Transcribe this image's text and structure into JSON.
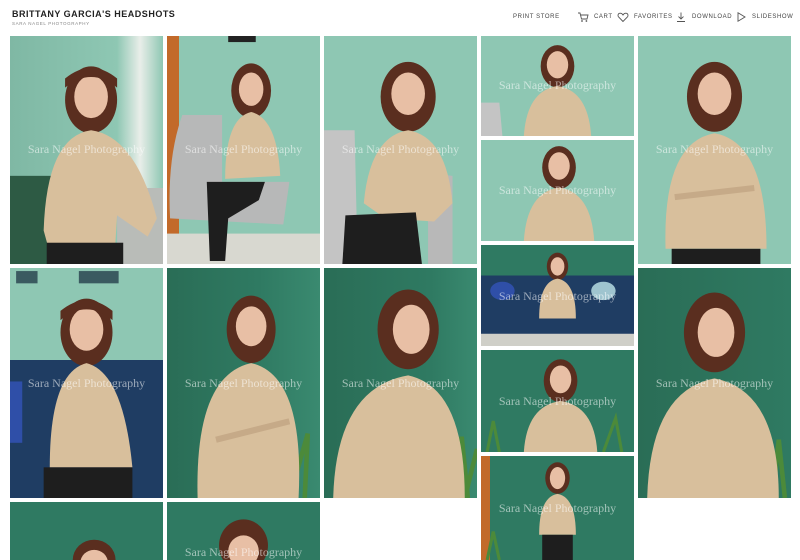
{
  "header": {
    "title": "BRITTANY GARCIA'S HEADSHOTS",
    "subtitle": "SARA NAGEL PHOTOGRAPHY"
  },
  "nav": {
    "print_store": "PRINT STORE",
    "cart": "CART",
    "favorites": "FAVORITES",
    "download": "DOWNLOAD",
    "slideshow": "SLIDESHOW"
  },
  "watermark": "Sara Nagel Photography",
  "icons": {
    "cart": "cart-icon",
    "favorites": "heart-icon",
    "download": "download-icon",
    "slideshow": "play-icon"
  },
  "colors": {
    "wall_mint": "#8ec7b3",
    "wall_green": "#2f7a62",
    "sofa_navy": "#1f3d63",
    "sweater": "#d8bf9c",
    "hair": "#5a2e1f"
  }
}
